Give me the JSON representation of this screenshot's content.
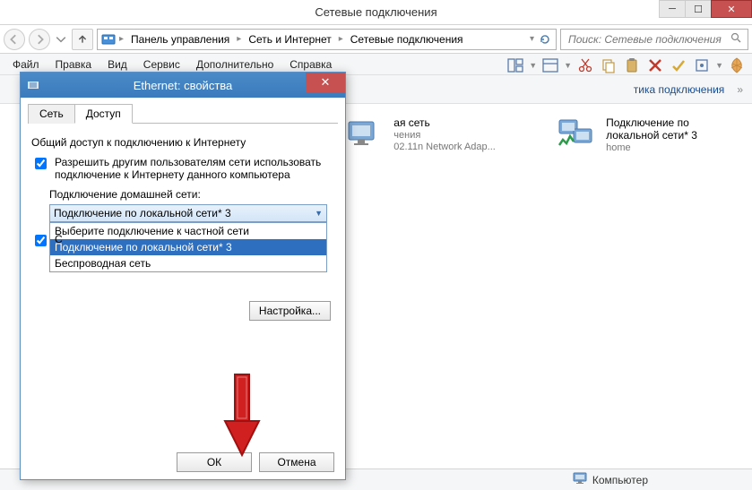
{
  "window": {
    "title": "Сетевые подключения",
    "controls": {
      "min": "─",
      "max": "☐",
      "close": "✕"
    }
  },
  "nav": {
    "breadcrumb": [
      "Панель управления",
      "Сеть и Интернет",
      "Сетевые подключения"
    ],
    "search_placeholder": "Поиск: Сетевые подключения"
  },
  "menu": [
    "Файл",
    "Правка",
    "Вид",
    "Сервис",
    "Дополнительно",
    "Справка"
  ],
  "cmdbar": {
    "diag": "тика подключения",
    "sep": "»"
  },
  "connections": [
    {
      "title": "ая сеть",
      "sub1": "чения",
      "sub2": "02.11n Network Adap..."
    },
    {
      "title": "Подключение по локальной сети* 3",
      "sub1": "home",
      "sub2": ""
    }
  ],
  "statusbar": {
    "label": "Компьютер"
  },
  "dialog": {
    "title": "Ethernet: свойства",
    "tabs": [
      "Сеть",
      "Доступ"
    ],
    "group": "Общий доступ к подключению к Интернету",
    "check1": "Разрешить другим пользователям сети использовать подключение к Интернету данного компьютера",
    "combo_label": "Подключение домашней сети:",
    "combo_value": "Подключение по локальной сети* 3",
    "dropdown": [
      "Выберите подключение к частной сети",
      "Подключение по локальной сети* 3",
      "Беспроводная сеть"
    ],
    "check2_prefix": "С",
    "settings_btn": "Настройка...",
    "ok": "ОК",
    "cancel": "Отмена"
  }
}
